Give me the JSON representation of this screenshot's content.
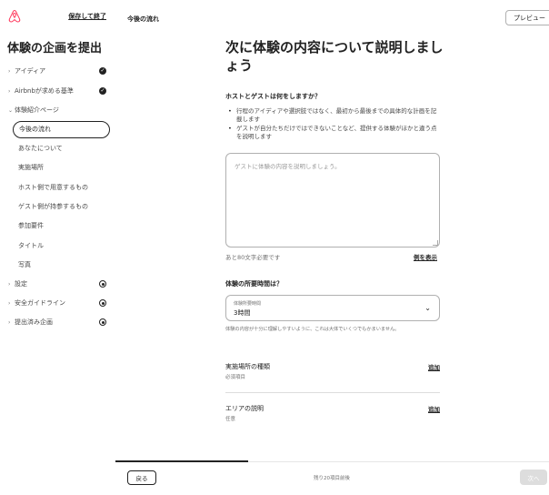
{
  "header": {
    "save_exit": "保存して終了",
    "breadcrumb": "今後の流れ",
    "preview": "プレビュー"
  },
  "sidebar": {
    "title": "体験の企画を提出",
    "sections": [
      {
        "label": "アイディア",
        "status": "done"
      },
      {
        "label": "Airbnbが求める基準",
        "status": "done"
      }
    ],
    "current_section": "体験紹介ページ",
    "sub_items": [
      "今後の流れ",
      "あなたについて",
      "実施場所",
      "ホスト側で用意するもの",
      "ゲスト側が持参するもの",
      "参加要件",
      "タイトル",
      "写真"
    ],
    "active_sub": 0,
    "later_sections": [
      {
        "label": "設定",
        "status": "locked"
      },
      {
        "label": "安全ガイドライン",
        "status": "locked"
      },
      {
        "label": "提出済み企画",
        "status": "locked"
      }
    ]
  },
  "main": {
    "title": "次に体験の内容について説明しましょう",
    "question1": "ホストとゲストは何をしますか？",
    "bullets": [
      "行程のアイディアや選択肢ではなく、最初から最後までの具体的な計画を記載します",
      "ゲストが自分たちだけではできないことなど、提供する体験がほかと違う点を説明します"
    ],
    "description_placeholder": "ゲストに体験の内容を説明しましょう。",
    "chars_left": "あと80文字必要です",
    "show_example": "例を表示",
    "question2": "体験の所要時間は？",
    "duration": {
      "caption": "体験所要時間",
      "value": "3時間",
      "note": "体験の内容が十分に理解しやすいように、これは大体でいくつでもかまいません。"
    },
    "rows": [
      {
        "title": "実施場所の種類",
        "meta": "必須項目",
        "action": "追加"
      },
      {
        "title": "エリアの説明",
        "meta": "任意",
        "action": "追加"
      }
    ]
  },
  "footer": {
    "back": "戻る",
    "remaining": "残り20項目前後",
    "next": "次へ",
    "progress": 0.31
  },
  "colors": {
    "text": "#222222",
    "muted": "#717171",
    "border": "#b0b0b0",
    "disabled_button": "#dddddd"
  },
  "icons": {
    "logo": "airbnb-logo-icon",
    "done": "check-circle-icon",
    "locked": "lock-circle-icon",
    "dropdown": "chevron-down-icon"
  }
}
